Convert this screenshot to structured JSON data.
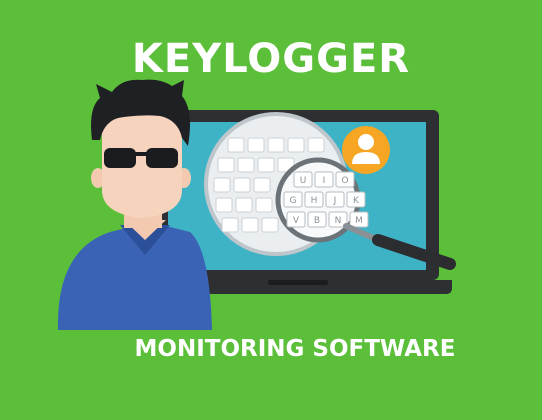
{
  "header": {
    "title": "KEYLOGGER"
  },
  "footer": {
    "subtitle": "MONITORING SOFTWARE"
  },
  "colors": {
    "background": "#5bbf3a",
    "laptop_frame": "#2d2f33",
    "screen": "#3fb3c6",
    "avatar_badge": "#f6a623",
    "shirt": "#3b63b5"
  },
  "icons": {
    "laptop": "laptop-icon",
    "magnifier": "magnifying-glass-icon",
    "user": "user-icon",
    "person": "spy-person-illustration"
  },
  "keyboard": {
    "row_top": [
      "U",
      "I",
      "O"
    ],
    "row_middle": [
      "G",
      "H",
      "J",
      "K"
    ],
    "row_bottom": [
      "V",
      "B",
      "N",
      "M"
    ]
  }
}
